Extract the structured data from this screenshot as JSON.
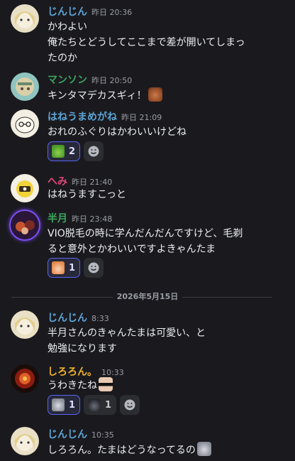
{
  "messages": [
    {
      "author": "じんじん",
      "author_color": "#5ea4d6",
      "time": "昨日 20:36",
      "lines": [
        "かわよい",
        "俺たちとどうしてここまで差が開いてしまっ",
        "たのか"
      ]
    },
    {
      "author": "マンソン",
      "author_color": "#3ba55d",
      "time": "昨日 20:50",
      "lines": [
        "キンタマデカスギィ！"
      ],
      "inline_emoji": "meat-emoji"
    },
    {
      "author": "はねうまめがね",
      "author_color": "#5ea4d6",
      "time": "昨日 21:09",
      "lines": [
        "おれのふぐりはかわいいけどね"
      ],
      "reactions": [
        {
          "emoji": "green-pepper-emoji",
          "count": "2",
          "active": true
        }
      ]
    },
    {
      "author": "へみ",
      "author_color": "#e0487a",
      "time": "昨日 21:40",
      "lines": [
        "はねうますこっと"
      ]
    },
    {
      "author": "半月",
      "author_color": "#3ba55d",
      "time": "昨日 23:48",
      "lines": [
        "VIO脱毛の時に学んだんだんですけど、毛剃",
        "ると意外とかわいいですよきゃんたま"
      ],
      "reactions": [
        {
          "emoji": "anime-face-emoji",
          "count": "1",
          "active": true
        }
      ]
    },
    {
      "author": "じんじん",
      "author_color": "#5ea4d6",
      "time": "8:33",
      "lines": [
        "半月さんのきゃんたまは可愛い、と",
        "勉強になります"
      ]
    },
    {
      "author": "しろろん。",
      "author_color": "#f0b232",
      "time": "10:33",
      "lines": [
        "うわきたね"
      ],
      "inline_emoji": "sunglasses-face-emoji",
      "reactions": [
        {
          "emoji": "cat-emoji",
          "count": "1",
          "active": true
        },
        {
          "emoji": "dark-figure-emoji",
          "count": "1",
          "active": false
        }
      ]
    },
    {
      "author": "じんじん",
      "author_color": "#5ea4d6",
      "time": "10:35",
      "lines": [
        "しろろん。たまはどうなってるの"
      ],
      "inline_emoji": "cat-emoji"
    }
  ],
  "date_divider": "2026年5月15日",
  "icons": {
    "add_reaction": "smiley-add-reaction-icon"
  },
  "colors": {
    "background": "#1a1a1e",
    "reaction_active_border": "#5865f2",
    "reaction_bg": "#2b2d31"
  }
}
